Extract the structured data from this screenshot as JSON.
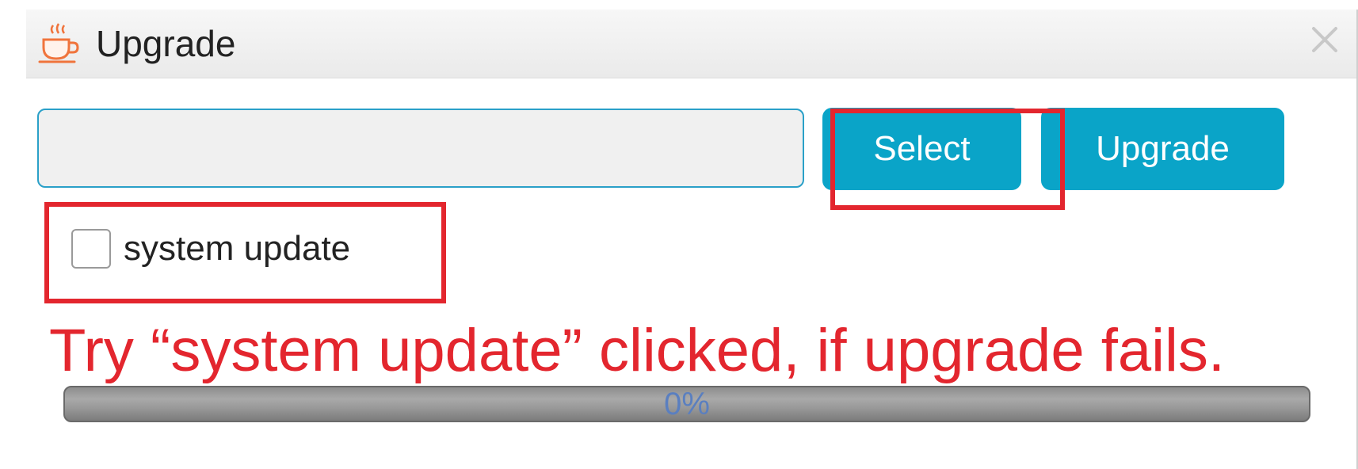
{
  "dialog": {
    "title": "Upgrade",
    "title_icon": "coffee-cup-icon",
    "close_icon": "close-icon"
  },
  "file_input": {
    "value": "",
    "placeholder": ""
  },
  "buttons": {
    "select_label": "Select",
    "upgrade_label": "Upgrade"
  },
  "checkbox": {
    "label": "system update",
    "checked": false
  },
  "annotation": {
    "text": "Try “system update” clicked, if upgrade fails."
  },
  "progress": {
    "label": "0%",
    "value": 0
  },
  "colors": {
    "accent": "#0aa4c8",
    "annotation_red": "#e3262e",
    "icon_orange": "#f0743c"
  }
}
